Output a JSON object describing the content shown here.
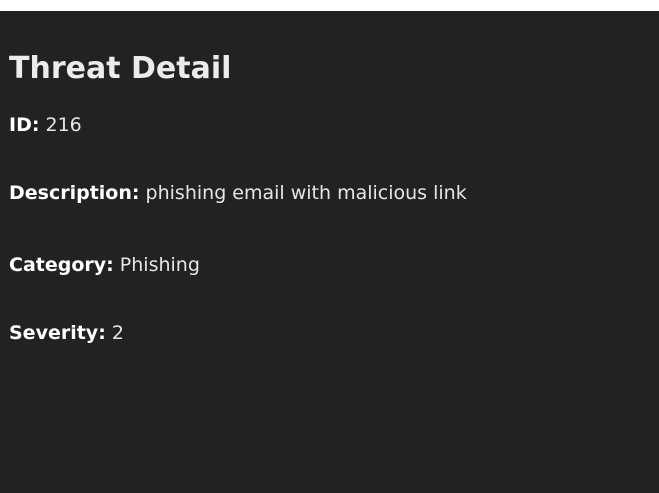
{
  "page": {
    "title": "Threat Detail"
  },
  "fields": {
    "id": {
      "label": "ID:",
      "value": "216"
    },
    "description": {
      "label": "Description:",
      "value": "phishing email with malicious link"
    },
    "category": {
      "label": "Category:",
      "value": "Phishing"
    },
    "severity": {
      "label": "Severity:",
      "value": "2"
    }
  },
  "colors": {
    "background": "#222222",
    "text": "#e6e6e6",
    "label": "#ffffff"
  }
}
